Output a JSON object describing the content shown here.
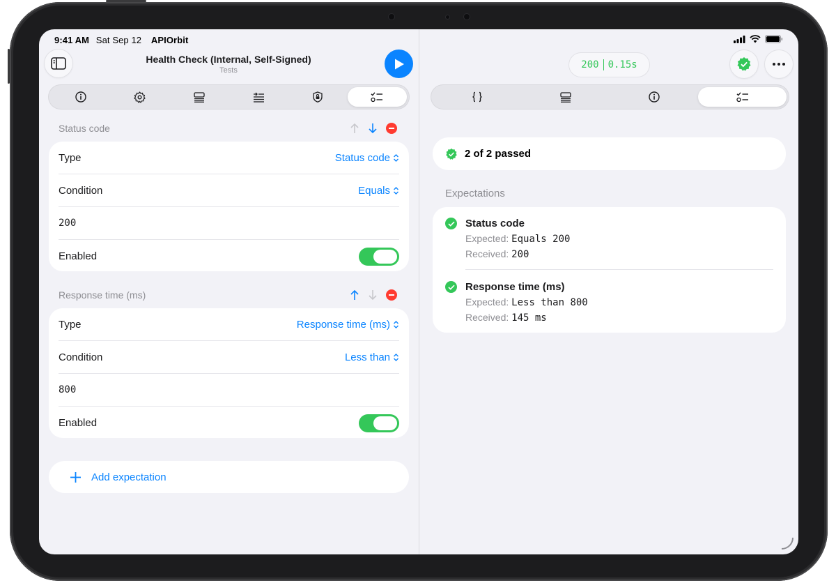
{
  "status_bar": {
    "time": "9:41 AM",
    "date": "Sat Sep 12",
    "app_name": "APIOrbit"
  },
  "request": {
    "title": "Health Check (Internal, Self-Signed)",
    "subtitle": "Tests"
  },
  "left_tabs": [
    "info-icon",
    "gear-icon",
    "body-icon",
    "headers-icon",
    "auth-shield-icon",
    "tests-icon"
  ],
  "left_tabs_selected": 5,
  "right_tabs": [
    "json-braces-icon",
    "body-icon",
    "info-icon",
    "tests-icon"
  ],
  "right_tabs_selected": 3,
  "expectations_editor": [
    {
      "header": "Status code",
      "type_label": "Type",
      "type_value": "Status code",
      "condition_label": "Condition",
      "condition_value": "Equals",
      "value": "200",
      "enabled_label": "Enabled",
      "enabled": true
    },
    {
      "header": "Response time (ms)",
      "type_label": "Type",
      "type_value": "Response time (ms)",
      "condition_label": "Condition",
      "condition_value": "Less than",
      "value": "800",
      "enabled_label": "Enabled",
      "enabled": true
    }
  ],
  "add_expectation_label": "Add expectation",
  "response": {
    "status_code": "200",
    "duration": "0.15s"
  },
  "results": {
    "summary": "2 of 2 passed",
    "section_title": "Expectations",
    "items": [
      {
        "title": "Status code",
        "expected_label": "Expected:",
        "expected_value": "Equals 200",
        "received_label": "Received:",
        "received_value": "200"
      },
      {
        "title": "Response time (ms)",
        "expected_label": "Expected:",
        "expected_value": "Less than 800",
        "received_label": "Received:",
        "received_value": "145 ms"
      }
    ]
  },
  "colors": {
    "accent": "#0a84ff",
    "success": "#34c759",
    "destructive": "#ff3b30",
    "background": "#f2f2f7"
  }
}
